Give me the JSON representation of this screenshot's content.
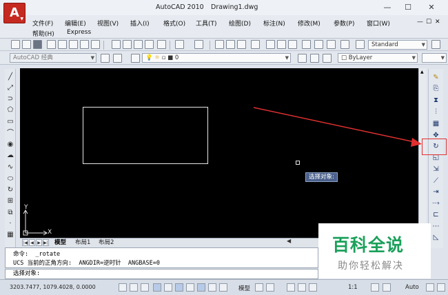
{
  "window": {
    "app_title": "AutoCAD 2010",
    "doc_title": "Drawing1.dwg",
    "minimize": "—",
    "maximize": "☐",
    "close": "✕",
    "logo": "A"
  },
  "menu": {
    "items": [
      "文件(F)",
      "编辑(E)",
      "视图(V)",
      "插入(I)",
      "格式(O)",
      "工具(T)",
      "绘图(D)",
      "标注(N)",
      "修改(M)",
      "参数(P)",
      "窗口(W)"
    ],
    "items_row2": [
      "帮助(H)",
      "Express"
    ],
    "mdi": [
      "—",
      "☐",
      "✕"
    ]
  },
  "toolbar": {
    "style_combo": "Standard",
    "workspace_combo": "AutoCAD 经典",
    "layer_combo": "0",
    "color_combo": "ByLayer"
  },
  "canvas": {
    "tooltip": "选择对象:",
    "ucs_y": "Y",
    "ucs_x": "X"
  },
  "tabs": {
    "nav": [
      "|◀",
      "◀",
      "▶",
      "▶|"
    ],
    "items": [
      "模型",
      "布局1",
      "布局2"
    ],
    "active": "模型"
  },
  "command": {
    "lines": [
      "命令:  _rotate",
      "UCS 当前的正角方向:  ANGDIR=逆时针  ANGBASE=0"
    ],
    "prompt": "选择对象:"
  },
  "status": {
    "coords": "3203.7477,  1079.4028,  0.0000",
    "model_label": "模型",
    "scale": "1:1",
    "auto": "Auto"
  },
  "watermark": {
    "title": "百科全说",
    "subtitle": "助你轻松解决"
  },
  "colors": {
    "canvas_bg": "#000000",
    "highlight": "#e03030",
    "tooltip_bg": "#4a5f8a",
    "watermark_green": "#1aa05a"
  }
}
